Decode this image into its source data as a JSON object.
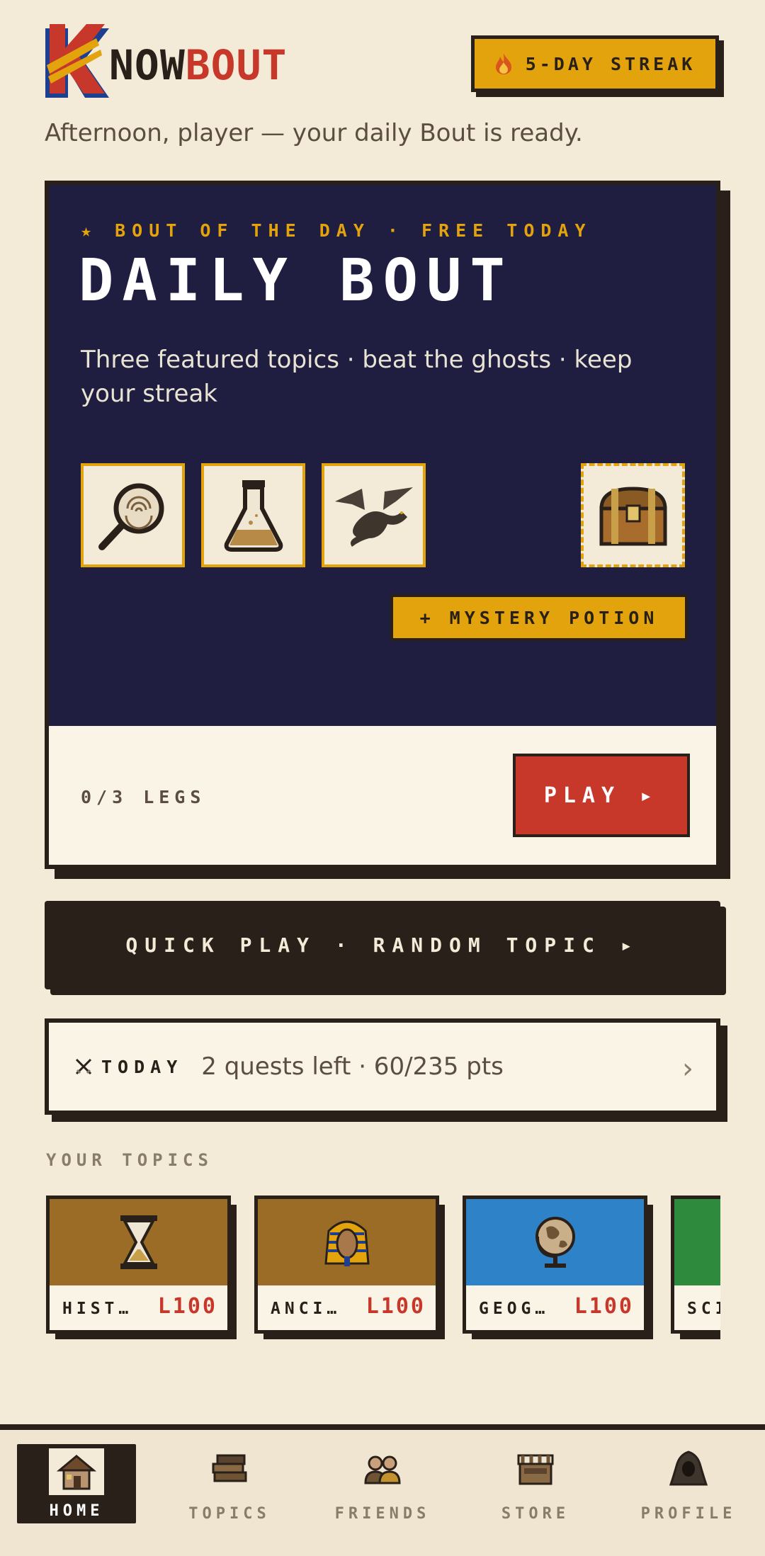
{
  "header": {
    "logo_k": "K",
    "logo_text_dark": "NOW",
    "logo_text_red": "BOUT",
    "streak_label": "5-DAY STREAK",
    "streak_icon": "flame-icon",
    "greeting": "Afternoon, player — your daily Bout is ready."
  },
  "daily": {
    "eyebrow": "★ BOUT OF THE DAY · FREE TODAY",
    "title": "DAILY BOUT",
    "subtitle": "Three featured topics · beat the ghosts · keep your streak",
    "topic_icons": [
      "magnifier-fingerprint-icon",
      "flask-icon",
      "dragon-icon"
    ],
    "chest_icon": "treasure-chest-icon",
    "mystery_label": "+ MYSTERY POTION",
    "progress_label": "0/3 LEGS",
    "play_label": "PLAY ▸"
  },
  "quick_play": {
    "label": "QUICK PLAY · RANDOM TOPIC ▸"
  },
  "today": {
    "icon": "crossed-swords-icon",
    "label": "TODAY",
    "text": "2 quests left · 60/235 pts",
    "chevron": "›"
  },
  "topics": {
    "heading": "YOUR TOPICS",
    "items": [
      {
        "name": "HIST…",
        "level": "L100",
        "color": "#9a6c26",
        "icon": "hourglass-icon"
      },
      {
        "name": "ANCI…",
        "level": "L100",
        "color": "#9a6c26",
        "icon": "pharaoh-icon"
      },
      {
        "name": "GEOG…",
        "level": "L100",
        "color": "#2e82c8",
        "icon": "globe-icon"
      },
      {
        "name": "SCI",
        "level": "",
        "color": "#2e8a3c",
        "icon": "science-icon"
      }
    ]
  },
  "nav": {
    "items": [
      {
        "label": "HOME",
        "icon": "house-icon",
        "active": true
      },
      {
        "label": "TOPICS",
        "icon": "books-icon",
        "active": false
      },
      {
        "label": "FRIENDS",
        "icon": "friends-icon",
        "active": false
      },
      {
        "label": "STORE",
        "icon": "market-stall-icon",
        "active": false
      },
      {
        "label": "PROFILE",
        "icon": "hooded-figure-icon",
        "active": false
      }
    ]
  },
  "colors": {
    "background": "#f3ead8",
    "ink": "#2a201a",
    "navy": "#1f1d40",
    "gold": "#e2a30c",
    "red": "#c7382b"
  }
}
